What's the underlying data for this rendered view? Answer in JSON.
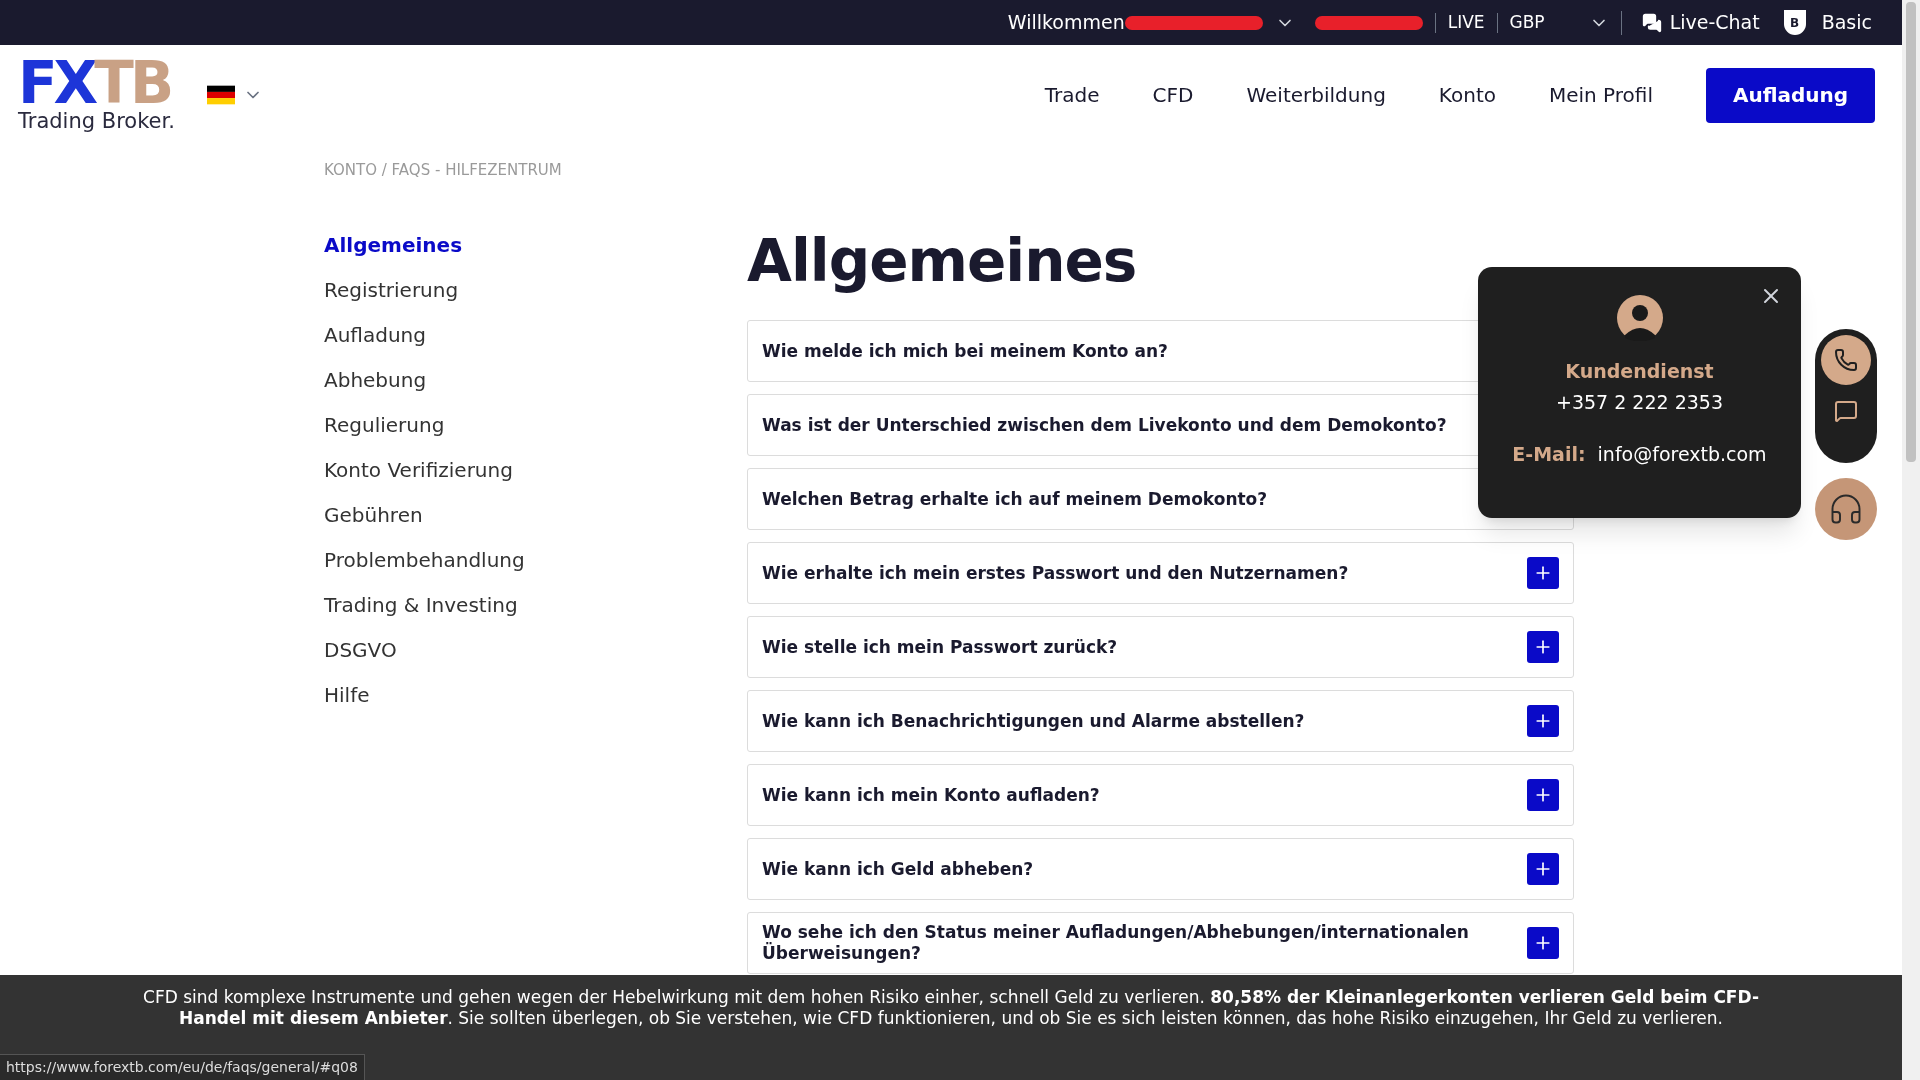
{
  "top_bar": {
    "welcome": "Willkommen",
    "account_type": "LIVE",
    "currency": "GBP",
    "live_chat": "Live-Chat",
    "level_badge": "B",
    "level": "Basic"
  },
  "header": {
    "logo_left": "FX",
    "logo_right": "TB",
    "logo_tagline": "Trading Broker.",
    "nav": [
      "Trade",
      "CFD",
      "Weiterbildung",
      "Konto",
      "Mein Profil"
    ],
    "cta": "Aufladung"
  },
  "breadcrumb": "KONTO / FAQS - HILFEZENTRUM",
  "sidebar": {
    "items": [
      {
        "label": "Allgemeines",
        "selected": true
      },
      {
        "label": "Registrierung",
        "selected": false
      },
      {
        "label": "Aufladung",
        "selected": false
      },
      {
        "label": "Abhebung",
        "selected": false
      },
      {
        "label": "Regulierung",
        "selected": false
      },
      {
        "label": "Konto Verifizierung",
        "selected": false
      },
      {
        "label": "Gebühren",
        "selected": false
      },
      {
        "label": "Problembehandlung",
        "selected": false
      },
      {
        "label": "Trading & Investing",
        "selected": false
      },
      {
        "label": "DSGVO",
        "selected": false
      },
      {
        "label": "Hilfe",
        "selected": false
      }
    ]
  },
  "heading": "Allgemeines",
  "faq": [
    {
      "question": "Wie melde ich mich bei meinem Konto an?",
      "expand_button": false
    },
    {
      "question": "Was ist der Unterschied zwischen dem Livekonto und dem Demokonto?",
      "expand_button": false
    },
    {
      "question": "Welchen Betrag erhalte ich auf meinem Demokonto?",
      "expand_button": false
    },
    {
      "question": "Wie erhalte ich mein erstes Passwort und den Nutzernamen?",
      "expand_button": true
    },
    {
      "question": "Wie stelle ich mein Passwort zurück?",
      "expand_button": true
    },
    {
      "question": "Wie kann ich Benachrichtigungen und Alarme abstellen?",
      "expand_button": true
    },
    {
      "question": "Wie kann ich mein Konto aufladen?",
      "expand_button": true
    },
    {
      "question": "Wie kann ich Geld abheben?",
      "expand_button": true
    },
    {
      "question": "Wo sehe ich den Status meiner Aufladungen/Abhebungen/internationalen Überweisungen?",
      "expand_button": true
    }
  ],
  "contact_popup": {
    "title": "Kundendienst",
    "phone": "+357 2 222 2353",
    "email_label": "E-Mail:",
    "email": "info@forextb.com"
  },
  "risk_banner": "CFD sind komplexe Instrumente und gehen wegen der Hebelwirkung mit dem hohen Risiko einher, schnell Geld zu verlieren. **80,58% der Kleinanlegerkonten verlieren Geld beim CFD-Handel mit diesem Anbieter**. Sie sollten überlegen, ob Sie verstehen, wie CFD funktionieren, und ob Sie es sich leisten können, das hohe Risiko einzugehen, Ihr Geld zu verlieren.",
  "status_url": "https://www.forextb.com/eu/de/faqs/general/#q08"
}
